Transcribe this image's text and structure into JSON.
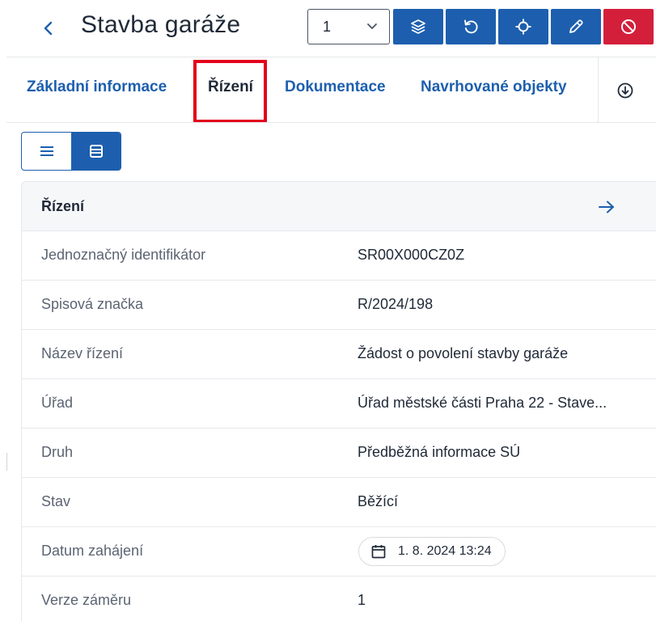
{
  "header": {
    "title": "Stavba garáže",
    "version_value": "1",
    "back_icon": "chevron-left-icon",
    "buttons": [
      {
        "icon": "layers-icon",
        "color": "#1d5fae"
      },
      {
        "icon": "refresh-icon",
        "color": "#1d5fae"
      },
      {
        "icon": "crosshair-icon",
        "color": "#1d5fae"
      },
      {
        "icon": "pencil-icon",
        "color": "#1d5fae"
      },
      {
        "icon": "block-icon",
        "color": "#d31f3a"
      }
    ]
  },
  "tabs": {
    "items": [
      {
        "label": "Základní informace",
        "active": false
      },
      {
        "label": "Řízení",
        "active": true
      },
      {
        "label": "Dokumentace",
        "active": false
      },
      {
        "label": "Navrhované objekty",
        "active": false
      }
    ],
    "more_icon": "circle-arrow-down-icon",
    "highlight_color": "#e3001b"
  },
  "view_toggle": {
    "options": [
      {
        "icon": "list-icon",
        "active": false
      },
      {
        "icon": "table-rows-icon",
        "active": true
      }
    ]
  },
  "card": {
    "title": "Řízení",
    "arrow_icon": "arrow-right-icon",
    "rows": [
      {
        "label": "Jednoznačný identifikátor",
        "value": "SR00X000CZ0Z"
      },
      {
        "label": "Spisová značka",
        "value": "R/2024/198"
      },
      {
        "label": "Název řízení",
        "value": "Žádost o povolení stavby garáže"
      },
      {
        "label": "Úřad",
        "value": "Úřad městské části Praha 22 - Stave..."
      },
      {
        "label": "Druh",
        "value": "Předběžná informace SÚ"
      },
      {
        "label": "Stav",
        "value": "Běžící"
      },
      {
        "label": "Datum zahájení",
        "value": "1. 8. 2024 13:24",
        "icon": "calendar-icon"
      },
      {
        "label": "Verze záměru",
        "value": "1"
      }
    ]
  },
  "colors": {
    "primary": "#1d5fae",
    "danger": "#d31f3a",
    "border": "#e5e7eb",
    "card_header_bg": "#f6f7f9"
  }
}
